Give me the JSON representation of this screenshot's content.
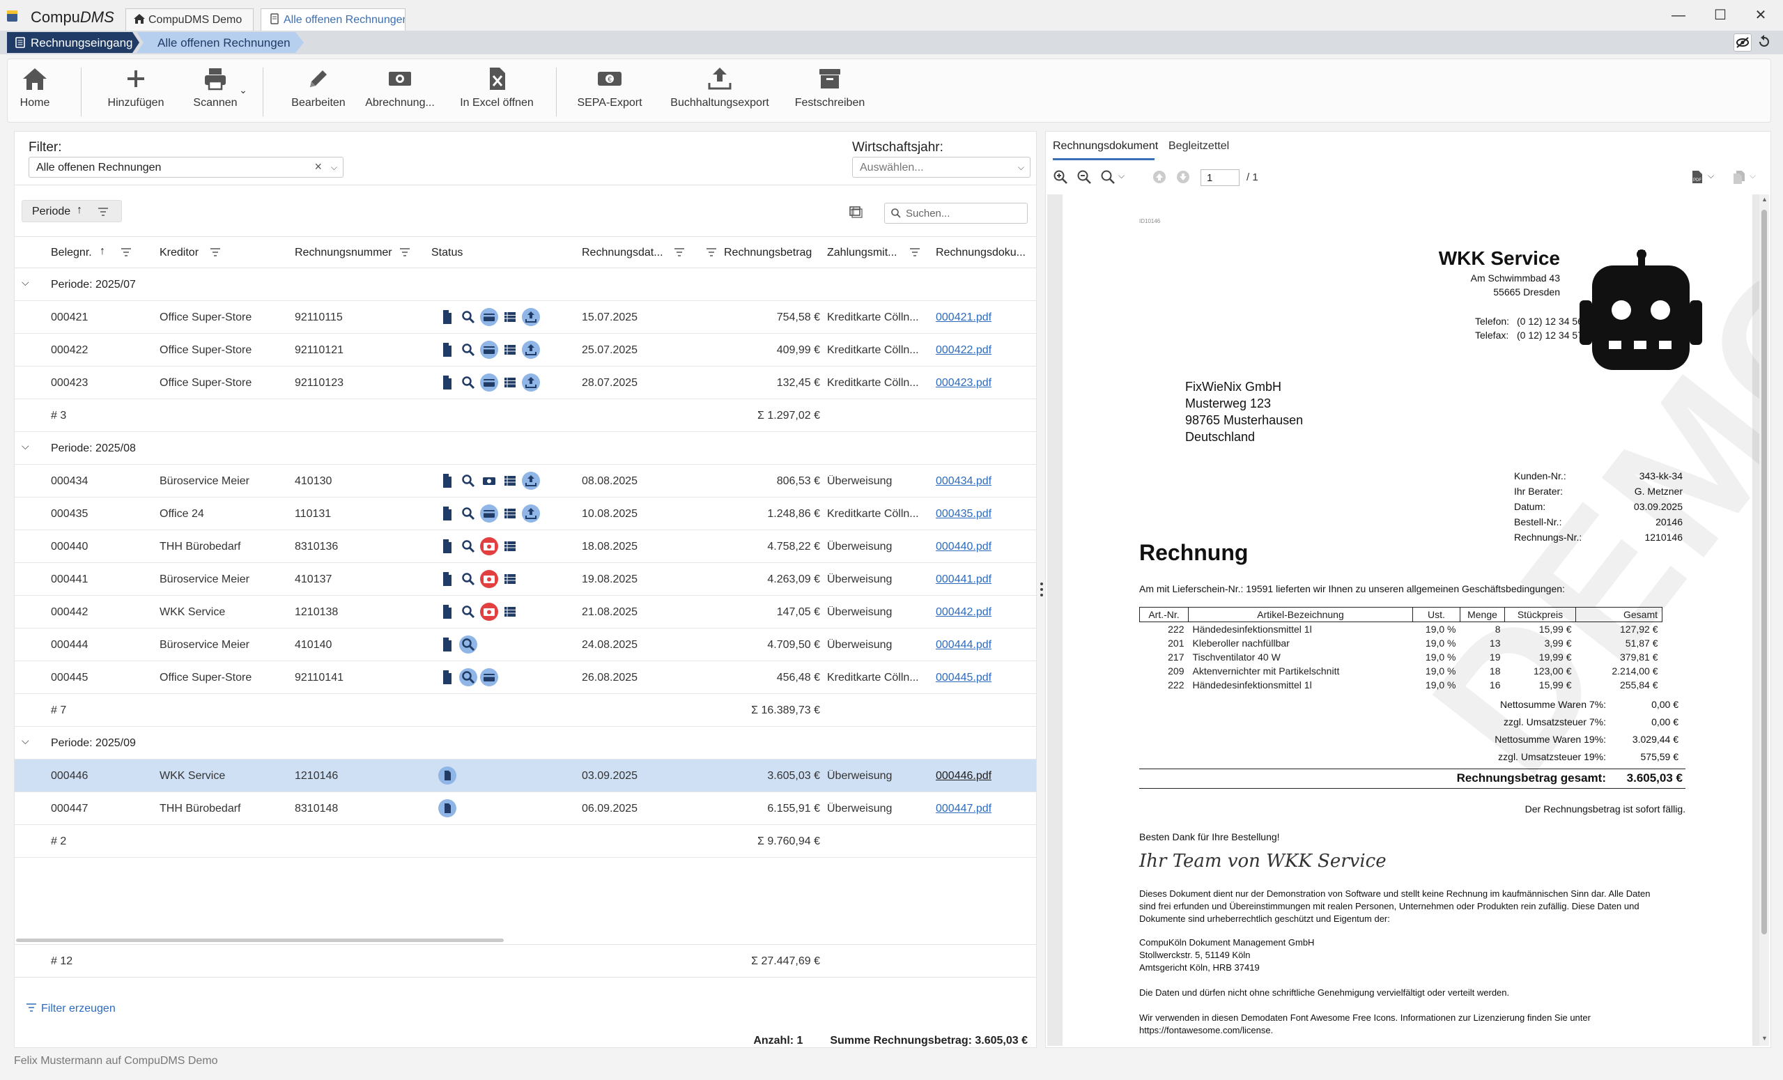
{
  "window": {
    "app_name_prefix": "Compu",
    "app_name_suffix": "DMS",
    "tabs": [
      {
        "label": "CompuDMS Demo"
      },
      {
        "label": "Alle offenen Rechnungen"
      }
    ],
    "controls": {
      "minimize": "—",
      "maximize": "☐",
      "close": "✕"
    }
  },
  "breadcrumb": {
    "items": [
      "Rechnungseingang",
      "Alle offenen Rechnungen"
    ]
  },
  "ribbon": {
    "home": "Home",
    "add": "Hinzufügen",
    "scan": "Scannen",
    "edit": "Bearbeiten",
    "billing": "Abrechnung...",
    "excel": "In Excel öffnen",
    "sepa": "SEPA-Export",
    "accounting": "Buchhaltungsexport",
    "finalize": "Festschreiben"
  },
  "filters": {
    "filter_label": "Filter:",
    "filter_value": "Alle offenen Rechnungen",
    "year_label": "Wirtschaftsjahr:",
    "year_placeholder": "Auswählen...",
    "group_chip": "Periode",
    "search_placeholder": "Suchen..."
  },
  "columns": [
    "Belegnr.",
    "Kreditor",
    "Rechnungsnummer",
    "Status",
    "Rechnungsdat...",
    "Rechnungsbetrag",
    "Zahlungsmit...",
    "Rechnungsdoku..."
  ],
  "groups": [
    {
      "title": "Periode: 2025/07",
      "rows": [
        {
          "nr": "000421",
          "creditor": "Office Super-Store",
          "invoice": "92110115",
          "status": [
            "doc",
            "search",
            "card",
            "list",
            "upload"
          ],
          "date": "15.07.2025",
          "amount": "754,58 €",
          "payment": "Kreditkarte Cölln...",
          "file": "000421.pdf"
        },
        {
          "nr": "000422",
          "creditor": "Office Super-Store",
          "invoice": "92110121",
          "status": [
            "doc",
            "search",
            "card",
            "list",
            "upload"
          ],
          "date": "25.07.2025",
          "amount": "409,99 €",
          "payment": "Kreditkarte Cölln...",
          "file": "000422.pdf"
        },
        {
          "nr": "000423",
          "creditor": "Office Super-Store",
          "invoice": "92110123",
          "status": [
            "doc",
            "search",
            "card",
            "list",
            "upload"
          ],
          "date": "28.07.2025",
          "amount": "132,45 €",
          "payment": "Kreditkarte Cölln...",
          "file": "000423.pdf"
        }
      ],
      "count": "# 3",
      "sum": "Σ 1.297,02 €"
    },
    {
      "title": "Periode: 2025/08",
      "rows": [
        {
          "nr": "000434",
          "creditor": "Büroservice Meier",
          "invoice": "410130",
          "status": [
            "doc",
            "search",
            "money",
            "list",
            "upload"
          ],
          "date": "08.08.2025",
          "amount": "806,53 €",
          "payment": "Überweisung",
          "file": "000434.pdf"
        },
        {
          "nr": "000435",
          "creditor": "Office 24",
          "invoice": "110131",
          "status": [
            "doc",
            "search",
            "card",
            "list",
            "upload"
          ],
          "date": "10.08.2025",
          "amount": "1.248,86 €",
          "payment": "Kreditkarte Cölln...",
          "file": "000435.pdf"
        },
        {
          "nr": "000440",
          "creditor": "THH Bürobedarf",
          "invoice": "8310136",
          "status": [
            "doc",
            "search",
            "money-red",
            "list"
          ],
          "date": "18.08.2025",
          "amount": "4.758,22 €",
          "payment": "Überweisung",
          "file": "000440.pdf"
        },
        {
          "nr": "000441",
          "creditor": "Büroservice Meier",
          "invoice": "410137",
          "status": [
            "doc",
            "search",
            "money-red",
            "list"
          ],
          "date": "19.08.2025",
          "amount": "4.263,09 €",
          "payment": "Überweisung",
          "file": "000441.pdf"
        },
        {
          "nr": "000442",
          "creditor": "WKK Service",
          "invoice": "1210138",
          "status": [
            "doc",
            "search",
            "money-red",
            "list"
          ],
          "date": "21.08.2025",
          "amount": "147,05 €",
          "payment": "Überweisung",
          "file": "000442.pdf"
        },
        {
          "nr": "000444",
          "creditor": "Büroservice Meier",
          "invoice": "410140",
          "status": [
            "doc",
            "search"
          ],
          "date": "24.08.2025",
          "amount": "4.709,50 €",
          "payment": "Überweisung",
          "file": "000444.pdf"
        },
        {
          "nr": "000445",
          "creditor": "Office Super-Store",
          "invoice": "92110141",
          "status": [
            "doc",
            "search",
            "card"
          ],
          "date": "26.08.2025",
          "amount": "456,48 €",
          "payment": "Kreditkarte Cölln...",
          "file": "000445.pdf"
        }
      ],
      "count": "# 7",
      "sum": "Σ 16.389,73 €"
    },
    {
      "title": "Periode: 2025/09",
      "rows": [
        {
          "nr": "000446",
          "creditor": "WKK Service",
          "invoice": "1210146",
          "status": [
            "doc-circle"
          ],
          "date": "03.09.2025",
          "amount": "3.605,03 €",
          "payment": "Überweisung",
          "file": "000446.pdf",
          "selected": true
        },
        {
          "nr": "000447",
          "creditor": "THH Bürobedarf",
          "invoice": "8310148",
          "status": [
            "doc-circle"
          ],
          "date": "06.09.2025",
          "amount": "6.155,91 €",
          "payment": "Überweisung",
          "file": "000447.pdf"
        }
      ],
      "count": "# 2",
      "sum": "Σ 9.760,94 €"
    }
  ],
  "totals": {
    "count": "# 12",
    "sum": "Σ 27.447,69 €"
  },
  "footer": {
    "filter_create": "Filter erzeugen",
    "count_label": "Anzahl: 1",
    "sum_label": "Summe Rechnungsbetrag: 3.605,03 €"
  },
  "viewer": {
    "tabs": [
      "Rechnungsdokument",
      "Begleitzettel"
    ],
    "page": "1",
    "page_total": "/ 1"
  },
  "document": {
    "doc_id": "ID10146",
    "company": "WKK Service",
    "street": "Am Schwimmbad 43",
    "city": "55665 Dresden",
    "phone_label": "Telefon:",
    "phone": "(0 12) 12 34 56",
    "fax_label": "Telefax:",
    "fax": "(0 12) 12 34 57",
    "recipient": [
      "FixWieNix GmbH",
      "Musterweg 123",
      "98765 Musterhausen",
      "Deutschland"
    ],
    "meta": [
      {
        "label": "Kunden-Nr.:",
        "value": "343-kk-34"
      },
      {
        "label": "Ihr Berater:",
        "value": "G. Metzner"
      },
      {
        "label": "Datum:",
        "value": "03.09.2025"
      },
      {
        "label": "Bestell-Nr.:",
        "value": "20146"
      },
      {
        "label": "Rechnungs-Nr.:",
        "value": "1210146"
      }
    ],
    "title": "Rechnung",
    "intro": "Am  mit Lieferschein-Nr.: 19591 lieferten wir Ihnen zu unseren allgemeinen Geschäftsbedingungen:",
    "table_headers": [
      "Art.-Nr.",
      "Artikel-Bezeichnung",
      "Ust.",
      "Menge",
      "Stückpreis",
      "Gesamt"
    ],
    "items": [
      [
        "222",
        "Händedesinfektionsmittel 1l",
        "19,0 %",
        "8",
        "15,99 €",
        "127,92 €"
      ],
      [
        "201",
        "Kleberoller nachfüllbar",
        "19,0 %",
        "13",
        "3,99 €",
        "51,87 €"
      ],
      [
        "217",
        "Tischventilator  40 W",
        "19,0 %",
        "19",
        "19,99 €",
        "379,81 €"
      ],
      [
        "209",
        "Aktenvernichter mit Partikelschnitt",
        "19,0 %",
        "18",
        "123,00 €",
        "2.214,00 €"
      ],
      [
        "222",
        "Händedesinfektionsmittel 1l",
        "19,0 %",
        "16",
        "15,99 €",
        "255,84 €"
      ]
    ],
    "sums": [
      {
        "label": "Nettosumme Waren 7%:",
        "value": "0,00 €"
      },
      {
        "label": "zzgl. Umsatzsteuer 7%:",
        "value": "0,00 €"
      },
      {
        "label": "Nettosumme Waren 19%:",
        "value": "3.029,44 €"
      },
      {
        "label": "zzgl. Umsatzsteuer 19%:",
        "value": "575,59 €"
      }
    ],
    "grand_total_label": "Rechnungsbetrag gesamt:",
    "grand_total": "3.605,03 €",
    "due": "Der Rechnungsbetrag ist sofort fällig.",
    "thanks": "Besten Dank für Ihre Bestellung!",
    "signature": "Ihr Team von WKK Service",
    "disclaimer": [
      "Dieses Dokument dient nur der Demonstration von Software und stellt keine Rechnung im kaufmännischen Sinn dar. Alle Daten",
      "sind frei erfunden und Übereinstimmungen mit realen Personen, Unternehmen oder Produkten rein zufällig. Diese Daten und",
      "Dokumente sind urheberrechtlich geschützt und Eigentum der:"
    ],
    "owner": [
      "CompuKöln Dokument Management GmbH",
      "Stollwerckstr. 5, 51149 Köln",
      "Amtsgericht Köln, HRB 37419"
    ],
    "copy_note": "Die Daten und dürfen nicht ohne schriftliche Genehmigung vervielfältigt oder verteilt werden.",
    "fa_note": [
      "Wir verwenden in diesen Demodaten Font Awesome Free Icons. Informationen zur Lizenzierung finden Sie unter",
      "https://fontawesome.com/license."
    ],
    "watermark": "DEMO"
  },
  "statusbar": {
    "text": "Felix Mustermann auf CompuDMS Demo"
  },
  "colors": {
    "accent": "#3b6fb5",
    "breadcrumb_dark": "#1f3b66",
    "selected_row": "#cfe0f5",
    "status_red": "#e24040",
    "status_blue": "#8fb6e6"
  }
}
